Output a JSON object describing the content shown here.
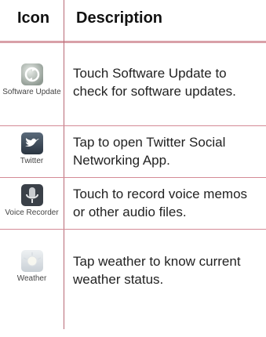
{
  "table": {
    "header": {
      "icon": "Icon",
      "description": "Description"
    },
    "rows": [
      {
        "icon_name": "software-update-icon",
        "label": "Software Update",
        "description": "Touch Software Update to check for software updates."
      },
      {
        "icon_name": "twitter-icon",
        "label": "Twitter",
        "description": "Tap to open Twitter Social Networking App."
      },
      {
        "icon_name": "voice-recorder-icon",
        "label": "Voice Recorder",
        "description": "Touch to record voice memos or other audio files."
      },
      {
        "icon_name": "weather-icon",
        "label": "Weather",
        "description": "Tap weather to know current weather status."
      }
    ]
  },
  "colors": {
    "divider": "#d48a96",
    "column_line": "#b86a76"
  }
}
